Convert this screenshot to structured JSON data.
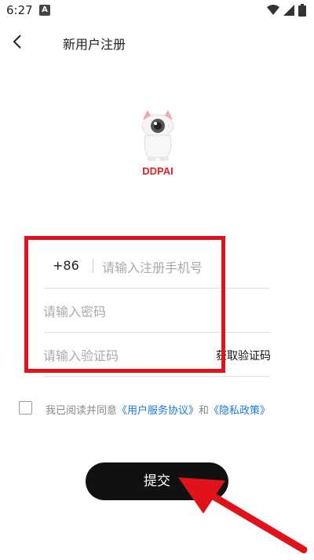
{
  "status_bar": {
    "time": "6:27",
    "notification_icon": "A",
    "icons": [
      "wifi-icon",
      "signal-icon",
      "battery-icon"
    ]
  },
  "header": {
    "back_icon": "chevron-left-icon",
    "title": "新用户注册"
  },
  "logo": {
    "brand_text": "DDPAI"
  },
  "form": {
    "country_code": "+86",
    "phone_placeholder": "请输入注册手机号",
    "password_placeholder": "请输入密码",
    "code_placeholder": "请输入验证码",
    "get_code_label": "获取验证码"
  },
  "agreement": {
    "prefix": "我已阅读并同意",
    "service_link": "《用户服务协议》",
    "and_text": "和",
    "privacy_link": "《隐私政策》"
  },
  "submit": {
    "label": "提交"
  },
  "colors": {
    "accent_link": "#1a7be0",
    "annotation_red": "#e0131a",
    "button_black": "#111111"
  }
}
